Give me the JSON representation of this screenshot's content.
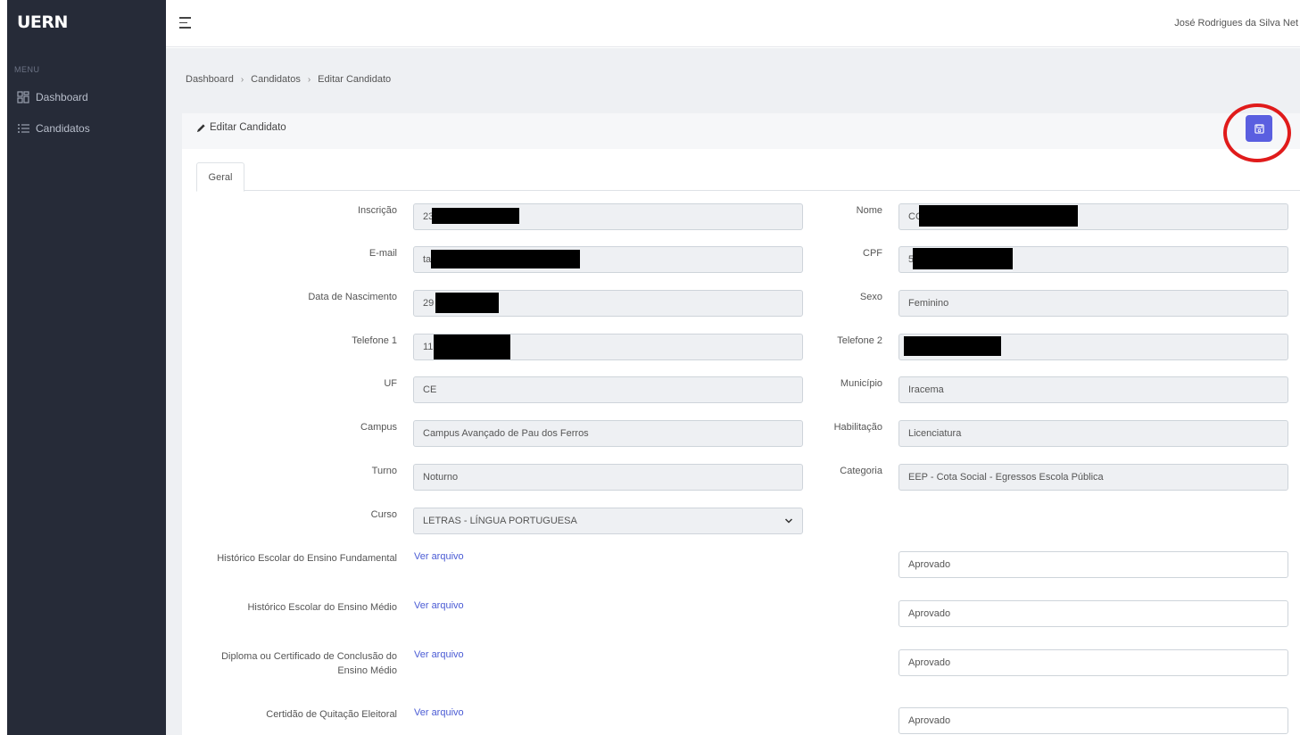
{
  "sidebar": {
    "logo": "UERN",
    "menu_caption": "MENU",
    "items": [
      {
        "label": "Dashboard",
        "icon": "dashboard-grid-icon"
      },
      {
        "label": "Candidatos",
        "icon": "list-icon"
      }
    ]
  },
  "topbar": {
    "user_name": "José Rodrigues da Silva Net"
  },
  "breadcrumb": [
    "Dashboard",
    "Candidatos",
    "Editar Candidato"
  ],
  "card": {
    "title": "Editar Candidato",
    "save_icon": "save-icon",
    "tab": "Geral"
  },
  "form": {
    "inscricao": {
      "label": "Inscrição",
      "value": "23"
    },
    "nome": {
      "label": "Nome",
      "value": "CC"
    },
    "email": {
      "label": "E-mail",
      "value": "ta"
    },
    "cpf": {
      "label": "CPF",
      "value": "5"
    },
    "nascimento": {
      "label": "Data de Nascimento",
      "value": "29"
    },
    "sexo": {
      "label": "Sexo",
      "value": "Feminino"
    },
    "telefone1": {
      "label": "Telefone 1",
      "value": "11"
    },
    "telefone2": {
      "label": "Telefone 2",
      "value": ""
    },
    "uf": {
      "label": "UF",
      "value": "CE"
    },
    "municipio": {
      "label": "Município",
      "value": "Iracema"
    },
    "campus": {
      "label": "Campus",
      "value": "Campus Avançado de Pau dos Ferros"
    },
    "habilitacao": {
      "label": "Habilitação",
      "value": "Licenciatura"
    },
    "turno": {
      "label": "Turno",
      "value": "Noturno"
    },
    "categoria": {
      "label": "Categoria",
      "value": "EEP - Cota Social - Egressos Escola Pública"
    },
    "curso": {
      "label": "Curso",
      "value": "LETRAS - LÍNGUA PORTUGUESA"
    }
  },
  "documents": [
    {
      "label": "Histórico Escolar do Ensino Fundamental",
      "link": "Ver arquivo",
      "status": "Aprovado"
    },
    {
      "label": "Histórico Escolar do Ensino Médio",
      "link": "Ver arquivo",
      "status": "Aprovado"
    },
    {
      "label_line1": "Diploma ou Certificado de Conclusão do",
      "label_line2": "Ensino Médio",
      "link": "Ver arquivo",
      "status": "Aprovado"
    },
    {
      "label": "Certidão de Quitação Eleitoral",
      "link": "Ver arquivo",
      "status": "Aprovado"
    }
  ],
  "colors": {
    "sidebar_bg": "#262b38",
    "accent": "#5a5fe0",
    "highlight_circle": "#e01b1b",
    "link": "#4a5bd4"
  }
}
